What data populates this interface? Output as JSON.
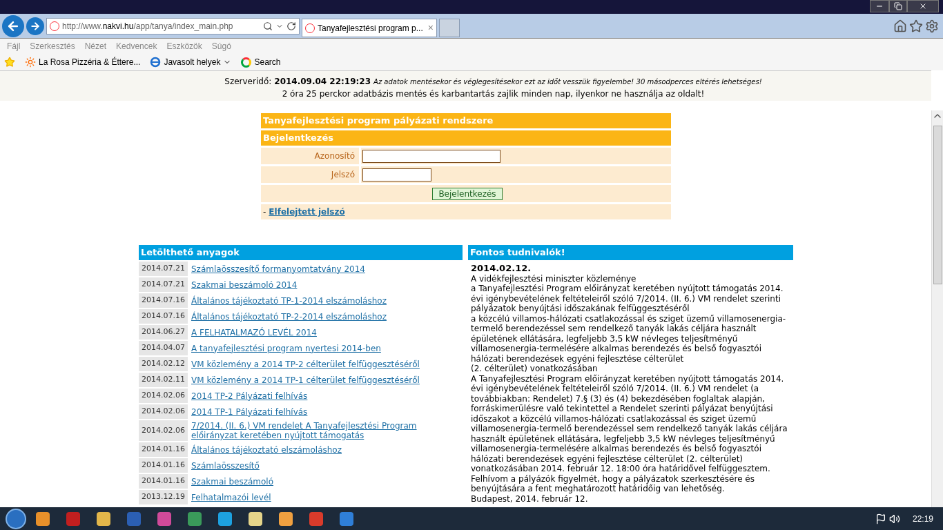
{
  "browser": {
    "url": {
      "prefix": "http://www.",
      "domain": "nakvi.hu",
      "path": "/app/tanya/index_main.php"
    },
    "tab": {
      "title": "Tanyafejlesztési program p...",
      "close": "×"
    },
    "menu": [
      "Fájl",
      "Szerkesztés",
      "Nézet",
      "Kedvencek",
      "Eszközök",
      "Súgó"
    ],
    "favorites": [
      {
        "kind": "site",
        "label": "La Rosa Pizzéria & Éttere..."
      },
      {
        "kind": "dropdown",
        "label": "Javasolt helyek"
      },
      {
        "kind": "search",
        "label": "Search"
      }
    ]
  },
  "notice": {
    "label": "Szerveridő:",
    "time": "2014.09.04 22:19:23",
    "note": "Az adatok mentésekor és véglegesítésekor ezt az időt vesszük figyelembe! 30 másodperces eltérés lehetséges!",
    "maintenance": "2 óra 25 perckor adatbázis mentés és karbantartás zajlik minden nap, ilyenkor ne használja az oldalt!"
  },
  "login": {
    "title": "Tanyafejlesztési program pályázati rendszere",
    "subtitle": "Bejelentkezés",
    "fields": [
      {
        "label": "Azonosító",
        "kind": "text"
      },
      {
        "label": "Jelszó",
        "kind": "password"
      }
    ],
    "button": "Bejelentkezés",
    "forgot_prefix": "-",
    "forgot_link": "Elfelejtett jelszó"
  },
  "downloads": {
    "title": "Letölthető anyagok",
    "rows": [
      {
        "date": "2014.07.21",
        "title": "Számlaösszesítő formanyomtatvány 2014"
      },
      {
        "date": "2014.07.21",
        "title": "Szakmai beszámoló 2014"
      },
      {
        "date": "2014.07.16",
        "title": "Általános tájékoztató TP-1-2014 elszámoláshoz"
      },
      {
        "date": "2014.07.16",
        "title": "Általános tájékoztató TP-2-2014 elszámoláshoz"
      },
      {
        "date": "2014.06.27",
        "title": "A FELHATALMAZÓ LEVÉL 2014"
      },
      {
        "date": "2014.04.07",
        "title": "A tanyafejlesztési program nyertesi 2014-ben"
      },
      {
        "date": "2014.02.12",
        "title": "VM közlemény a 2014 TP-2 célterület felfüggesztéséről"
      },
      {
        "date": "2014.02.11",
        "title": "VM közlemény a 2014 TP-1 célterület felfüggesztéséről"
      },
      {
        "date": "2014.02.06",
        "title": "2014 TP-2 Pályázati felhívás"
      },
      {
        "date": "2014.02.06",
        "title": "2014 TP-1 Pályázati felhívás"
      },
      {
        "date": "2014.02.06",
        "title": "7/2014. (II. 6.) VM rendelet A Tanyafejlesztési Program előirányzat keretében nyújtott támogatás"
      },
      {
        "date": "2014.01.16",
        "title": "Általános tájékoztató elszámoláshoz"
      },
      {
        "date": "2014.01.16",
        "title": "Számlaösszesítő"
      },
      {
        "date": "2014.01.16",
        "title": "Szakmai beszámoló"
      },
      {
        "date": "2013.12.19",
        "title": "Felhatalmazói levél"
      }
    ]
  },
  "news": {
    "title": "Fontos tudnivalók!",
    "date": "2014.02.12.",
    "paragraphs": [
      "A vidékfejlesztési miniszter közleménye",
      "a Tanyafejlesztési Program előirányzat keretében nyújtott támogatás 2014. évi igénybevételének feltételeiről szóló 7/2014. (II. 6.) VM rendelet szerinti pályázatok benyújtási időszakának felfüggesztéséről",
      "a közcélú villamos-hálózati csatlakozással és sziget üzemű villamosenergia-termelő berendezéssel sem rendelkező tanyák lakás céljára használt épületének ellátására, legfeljebb 3,5 kW névleges teljesítményű villamosenergia-termelésére alkalmas berendezés és belső fogyasztói hálózati berendezések egyéni fejlesztése célterület",
      "(2. célterület) vonatkozásában",
      "A Tanyafejlesztési Program előirányzat keretében nyújtott támogatás 2014. évi igénybevételének feltételeiről szóló 7/2014. (II. 6.) VM rendelet (a továbbiakban: Rendelet) 7.§ (3) és (4) bekezdésében foglaltak alapján, forráskimerülésre való tekintettel a Rendelet szerinti pályázat benyújtási időszakot a közcélú villamos-hálózati csatlakozással és sziget üzemű villamosenergia-termelő berendezéssel sem rendelkező tanyák lakás céljára használt épületének ellátására, legfeljebb 3,5 kW névleges teljesítményű villamosenergia-termelésére alkalmas berendezés és belső fogyasztói hálózati berendezések egyéni fejlesztése célterület (2. célterület) vonatkozásában 2014. február 12. 18:00 óra határidővel felfüggesztem.",
      "Felhívom a pályázók figyelmét, hogy a pályázatok szerkesztésére és benyújtására a fent meghatározott határidőig van lehetőség.",
      "Budapest, 2014. február 12."
    ]
  },
  "taskbar": {
    "clock": "22:19"
  }
}
